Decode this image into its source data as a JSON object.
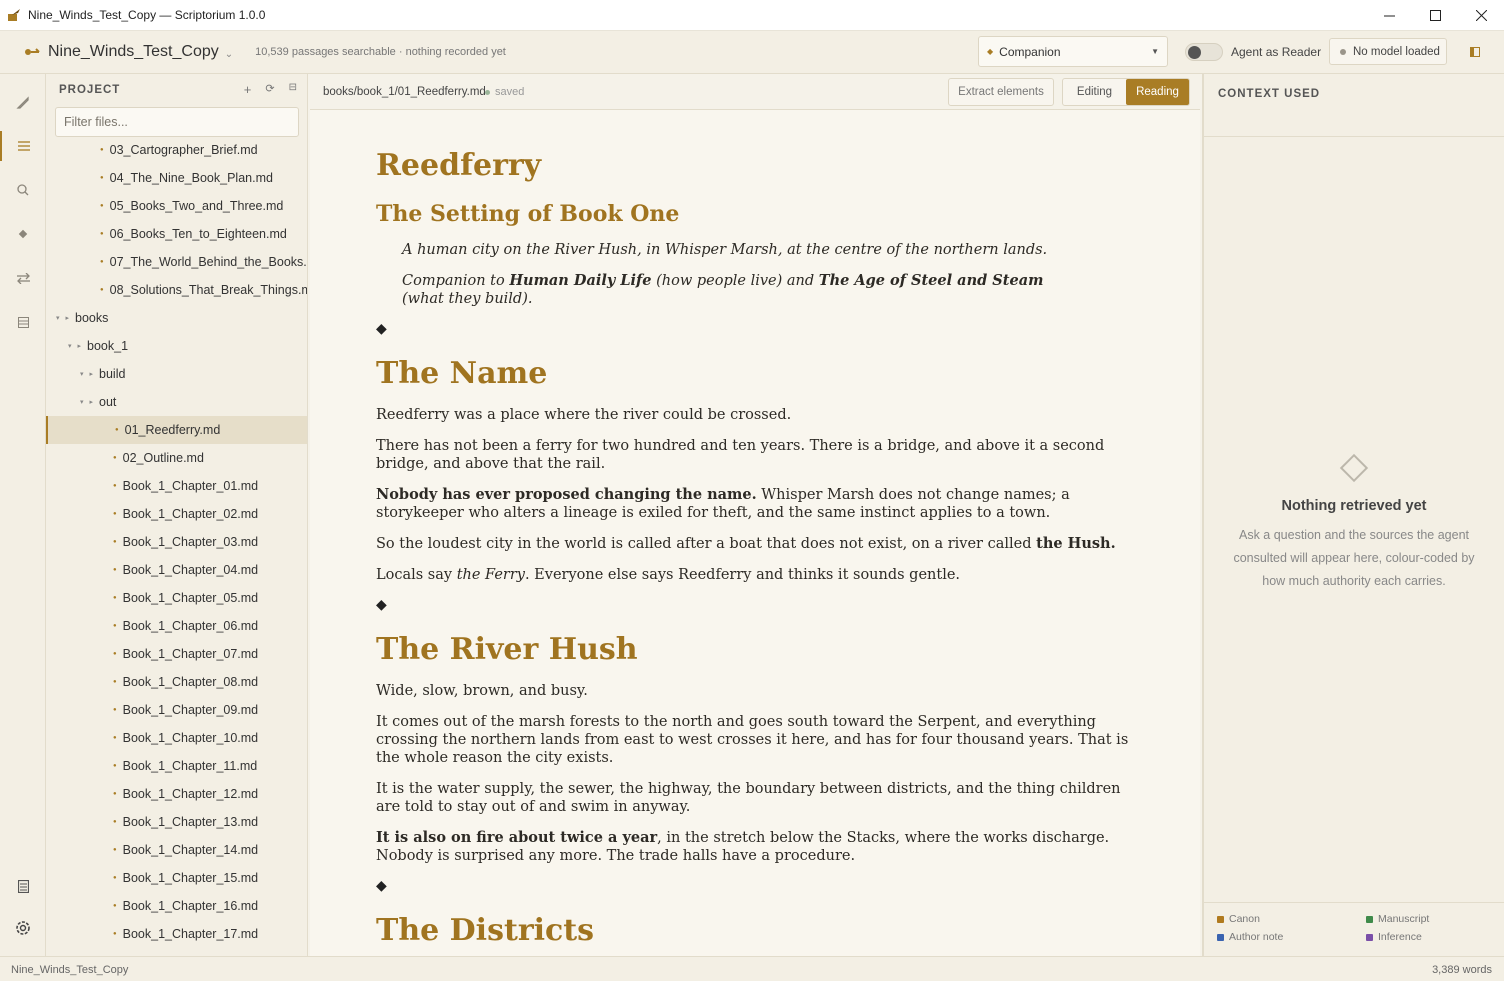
{
  "window": {
    "title": "Nine_Winds_Test_Copy — Scriptorium 1.0.0",
    "app_icon": "quill-book-icon",
    "controls": [
      "minimize",
      "maximize",
      "close"
    ]
  },
  "toolbar": {
    "project_name": "Nine_Winds_Test_Copy",
    "project_status": "10,539 passages searchable · nothing recorded yet",
    "mode_value": "Companion",
    "agent_toggle_label": "Agent as Reader",
    "model_status": "No model loaded"
  },
  "rail": {
    "items": [
      "quill-icon",
      "files-icon",
      "search-icon",
      "tag-icon",
      "swap-icon",
      "grid-icon"
    ],
    "bottom": [
      "notes-icon",
      "gear-icon"
    ]
  },
  "sidebar": {
    "heading": "PROJECT",
    "filter_placeholder": "Filter files...",
    "tree": [
      {
        "label": "03_Cartographer_Brief.md",
        "type": "file",
        "depth": 1
      },
      {
        "label": "04_The_Nine_Book_Plan.md",
        "type": "file",
        "depth": 1
      },
      {
        "label": "05_Books_Two_and_Three.md",
        "type": "file",
        "depth": 1
      },
      {
        "label": "06_Books_Ten_to_Eighteen.md",
        "type": "file",
        "depth": 1
      },
      {
        "label": "07_The_World_Behind_the_Books.md",
        "type": "file",
        "depth": 1
      },
      {
        "label": "08_Solutions_That_Break_Things.md",
        "type": "file",
        "depth": 1
      },
      {
        "label": "books",
        "type": "folder",
        "depth": 0
      },
      {
        "label": "book_1",
        "type": "folder",
        "depth": 1
      },
      {
        "label": "build",
        "type": "folder",
        "depth": 2
      },
      {
        "label": "out",
        "type": "folder",
        "depth": 2
      },
      {
        "label": "01_Reedferry.md",
        "type": "file",
        "depth": 2,
        "selected": true
      },
      {
        "label": "02_Outline.md",
        "type": "file",
        "depth": 2
      },
      {
        "label": "Book_1_Chapter_01.md",
        "type": "file",
        "depth": 2
      },
      {
        "label": "Book_1_Chapter_02.md",
        "type": "file",
        "depth": 2
      },
      {
        "label": "Book_1_Chapter_03.md",
        "type": "file",
        "depth": 2
      },
      {
        "label": "Book_1_Chapter_04.md",
        "type": "file",
        "depth": 2
      },
      {
        "label": "Book_1_Chapter_05.md",
        "type": "file",
        "depth": 2
      },
      {
        "label": "Book_1_Chapter_06.md",
        "type": "file",
        "depth": 2
      },
      {
        "label": "Book_1_Chapter_07.md",
        "type": "file",
        "depth": 2
      },
      {
        "label": "Book_1_Chapter_08.md",
        "type": "file",
        "depth": 2
      },
      {
        "label": "Book_1_Chapter_09.md",
        "type": "file",
        "depth": 2
      },
      {
        "label": "Book_1_Chapter_10.md",
        "type": "file",
        "depth": 2
      },
      {
        "label": "Book_1_Chapter_11.md",
        "type": "file",
        "depth": 2
      },
      {
        "label": "Book_1_Chapter_12.md",
        "type": "file",
        "depth": 2
      },
      {
        "label": "Book_1_Chapter_13.md",
        "type": "file",
        "depth": 2
      },
      {
        "label": "Book_1_Chapter_14.md",
        "type": "file",
        "depth": 2
      },
      {
        "label": "Book_1_Chapter_15.md",
        "type": "file",
        "depth": 2
      },
      {
        "label": "Book_1_Chapter_16.md",
        "type": "file",
        "depth": 2
      },
      {
        "label": "Book_1_Chapter_17.md",
        "type": "file",
        "depth": 2
      }
    ]
  },
  "editor": {
    "path": "books/book_1/01_Reedferry.md",
    "save_state": "saved",
    "extract_label": "Extract elements",
    "mode_editing": "Editing",
    "mode_reading": "Reading"
  },
  "document": {
    "title": "Reedferry",
    "subtitle": "The Setting of Book One",
    "quote1": "A human city on the River Hush, in Whisper Marsh, at the centre of the northern lands.",
    "quote2_a": "Companion to ",
    "quote2_b": "Human Daily Life",
    "quote2_c": " (how people live) and ",
    "quote2_d": "The Age of Steel and Steam",
    "quote2_e": " (what they build).",
    "sep": "◆",
    "h_name": "The Name",
    "name_p1": "Reedferry was a place where the river could be crossed.",
    "name_p2": "There has not been a ferry for two hundred and ten years. There is a bridge, and above it a second bridge, and above that the rail.",
    "name_p3_bold": "Nobody has ever proposed changing the name.",
    "name_p3_rest": " Whisper Marsh does not change names; a storykeeper who alters a lineage is exiled for theft, and the same instinct applies to a town.",
    "name_p4_a": "So the loudest city in the world is called after a boat that does not exist, on a river called ",
    "name_p4_b": "the Hush.",
    "name_p5_a": "Locals say ",
    "name_p5_b": "the Ferry",
    "name_p5_c": ". Everyone else says Reedferry and thinks it sounds gentle.",
    "h_river": "The River Hush",
    "river_p1": "Wide, slow, brown, and busy.",
    "river_p2": "It comes out of the marsh forests to the north and goes south toward the Serpent, and everything crossing the northern lands from east to west crosses it here, and has for four thousand years. That is the whole reason the city exists.",
    "river_p3": "It is the water supply, the sewer, the highway, the boundary between districts, and the thing children are told to stay out of and swim in anyway.",
    "river_p4_bold": "It is also on fire about twice a year",
    "river_p4_rest": ", in the stretch below the Stacks, where the works discharge. Nobody is surprised any more. The trade halls have a procedure.",
    "h_districts": "The Districts"
  },
  "context": {
    "heading": "CONTEXT USED",
    "empty_title": "Nothing retrieved yet",
    "empty_text": "Ask a question and the sources the agent consulted will appear here, colour-coded by how much authority each carries.",
    "legend": [
      {
        "label": "Canon",
        "color": "#b07a1e"
      },
      {
        "label": "Manuscript",
        "color": "#3f8a4a"
      },
      {
        "label": "Author note",
        "color": "#3a63b0"
      },
      {
        "label": "Inference",
        "color": "#7a4fa8"
      }
    ]
  },
  "status": {
    "left": "Nine_Winds_Test_Copy",
    "right": "3,389 words"
  }
}
